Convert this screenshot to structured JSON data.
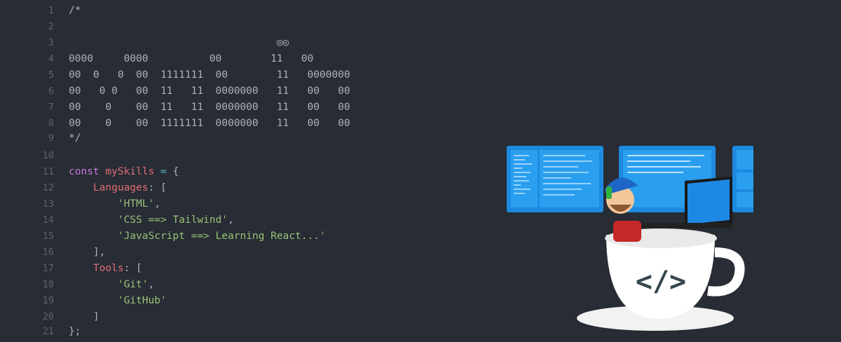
{
  "editor": {
    "lines": [
      {
        "n": "1",
        "tokens": [
          {
            "c": "cm",
            "t": "/*"
          }
        ]
      },
      {
        "n": "2",
        "tokens": []
      },
      {
        "n": "3",
        "tokens": [
          {
            "c": "cm",
            "t": "                                  ◎◎"
          }
        ]
      },
      {
        "n": "4",
        "tokens": [
          {
            "c": "cm",
            "t": "0000     0000          00        11   00"
          }
        ]
      },
      {
        "n": "5",
        "tokens": [
          {
            "c": "cm",
            "t": "00  0   0  00  1111111  00        11   0000000"
          }
        ]
      },
      {
        "n": "6",
        "tokens": [
          {
            "c": "cm",
            "t": "00   0 0   00  11   11  0000000   11   00   00"
          }
        ]
      },
      {
        "n": "7",
        "tokens": [
          {
            "c": "cm",
            "t": "00    0    00  11   11  0000000   11   00   00"
          }
        ]
      },
      {
        "n": "8",
        "tokens": [
          {
            "c": "cm",
            "t": "00    0    00  1111111  0000000   11   00   00"
          }
        ]
      },
      {
        "n": "9",
        "tokens": [
          {
            "c": "cm",
            "t": "*/"
          }
        ]
      },
      {
        "n": "10",
        "tokens": []
      },
      {
        "n": "11",
        "tokens": [
          {
            "c": "kw",
            "t": "const "
          },
          {
            "c": "prop",
            "t": "mySkills"
          },
          {
            "c": "op",
            "t": " = "
          },
          {
            "c": "pun",
            "t": "{"
          }
        ]
      },
      {
        "n": "12",
        "tokens": [
          {
            "c": "pun",
            "t": "    "
          },
          {
            "c": "prop",
            "t": "Languages"
          },
          {
            "c": "pun",
            "t": ": ["
          }
        ]
      },
      {
        "n": "13",
        "tokens": [
          {
            "c": "pun",
            "t": "        "
          },
          {
            "c": "str",
            "t": "'HTML'"
          },
          {
            "c": "pun",
            "t": ","
          }
        ]
      },
      {
        "n": "14",
        "tokens": [
          {
            "c": "pun",
            "t": "        "
          },
          {
            "c": "str",
            "t": "'CSS ==> Tailwind'"
          },
          {
            "c": "pun",
            "t": ","
          }
        ]
      },
      {
        "n": "15",
        "tokens": [
          {
            "c": "pun",
            "t": "        "
          },
          {
            "c": "str",
            "t": "'JavaScript ==> Learning React...'"
          }
        ]
      },
      {
        "n": "16",
        "tokens": [
          {
            "c": "pun",
            "t": "    ],"
          }
        ]
      },
      {
        "n": "17",
        "tokens": [
          {
            "c": "pun",
            "t": "    "
          },
          {
            "c": "prop",
            "t": "Tools"
          },
          {
            "c": "pun",
            "t": ": ["
          }
        ]
      },
      {
        "n": "18",
        "tokens": [
          {
            "c": "pun",
            "t": "        "
          },
          {
            "c": "str",
            "t": "'Git'"
          },
          {
            "c": "pun",
            "t": ","
          }
        ]
      },
      {
        "n": "19",
        "tokens": [
          {
            "c": "pun",
            "t": "        "
          },
          {
            "c": "str",
            "t": "'GitHub'"
          }
        ]
      },
      {
        "n": "20",
        "tokens": [
          {
            "c": "pun",
            "t": "    ]"
          }
        ]
      },
      {
        "n": "21",
        "tokens": [
          {
            "c": "pun",
            "t": "};"
          }
        ]
      }
    ]
  },
  "illustration": {
    "mug_symbol": "</>",
    "icons": [
      "angular-icon",
      "react-icon",
      "bootstrap-icon",
      "jquery-icon"
    ]
  },
  "colors": {
    "background": "#282c34",
    "line_number": "#5c6370",
    "keyword": "#c678dd",
    "property": "#e06c75",
    "string": "#98c379",
    "operator": "#56b6c2",
    "text": "#abb2bf",
    "panel_blue": "#1e88e5"
  }
}
